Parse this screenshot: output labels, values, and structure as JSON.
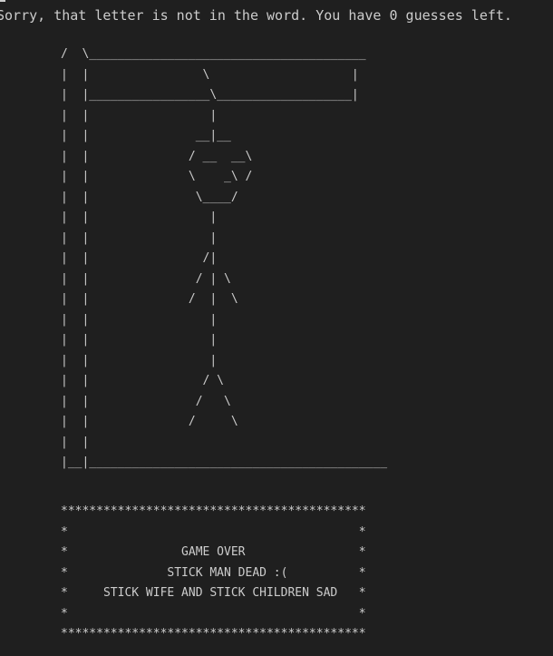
{
  "terminal": {
    "status_message": "Sorry, that letter is not in the word. You have 0 guesses left.",
    "hangman_art": "/  \\_______________________________________\n|  |                \\                    |\n|  |_________________\\___________________|\n|  |                 |\n|  |               __|__\n|  |              / __  __\\\n|  |              \\    _\\ /\n|  |               \\____/\n|  |                 |\n|  |                 |\n|  |                /|\n|  |               / | \\\n|  |              /  |  \\\n|  |                 |\n|  |                 |\n|  |                 |\n|  |                / \\\n|  |               /   \\\n|  |              /     \\\n|  |\n|__|__________________________________________",
    "game_over_box": "*******************************************\n*                                         *\n*                GAME OVER                *\n*              STICK MAN DEAD :(          *\n*     STICK WIFE AND STICK CHILDREN SAD   *\n*                                         *\n*******************************************"
  }
}
